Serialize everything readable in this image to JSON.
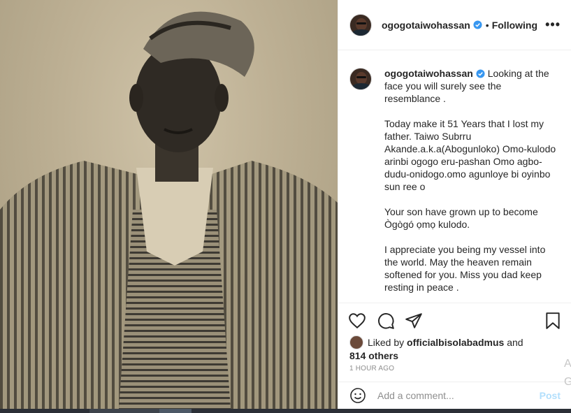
{
  "post": {
    "username": "ogogotaiwohassan",
    "follow_label": "Following",
    "separator": "•",
    "more_label": "•••"
  },
  "caption": {
    "username": "ogogotaiwohassan",
    "text": "Looking at the face you will surely see the resemblance .\n\nToday make it 51 Years that I lost my father. Taiwo Subrru Akande.a.k.a(Abogunloko) Omo-kulodo arinbi ogogo eru-pashan Omo agbo-dudu-onidogo.omo agunloye bi oyinbo sun ree o\n\nYour son have grown up to become Ògògó ọmọ kulodo.\n\nI appreciate you being my vessel into the world. May the heaven remain softened for you. Miss you dad keep resting in peace ."
  },
  "actions": {
    "icons": [
      "heart-icon",
      "comment-icon",
      "share-icon",
      "bookmark-icon"
    ]
  },
  "likes": {
    "prefix": "Liked by",
    "liker": "officialbisolabadmus",
    "conjunction": "and",
    "others": "814 others"
  },
  "time_ago": "1 HOUR AGO",
  "comment": {
    "placeholder": "Add a comment...",
    "post_label": "Post"
  },
  "side_letters": [
    "A",
    "G"
  ],
  "colors": {
    "verified_blue": "#3897f0",
    "post_disabled": "#b2dffc",
    "secondary_text": "#8e8e8e"
  }
}
